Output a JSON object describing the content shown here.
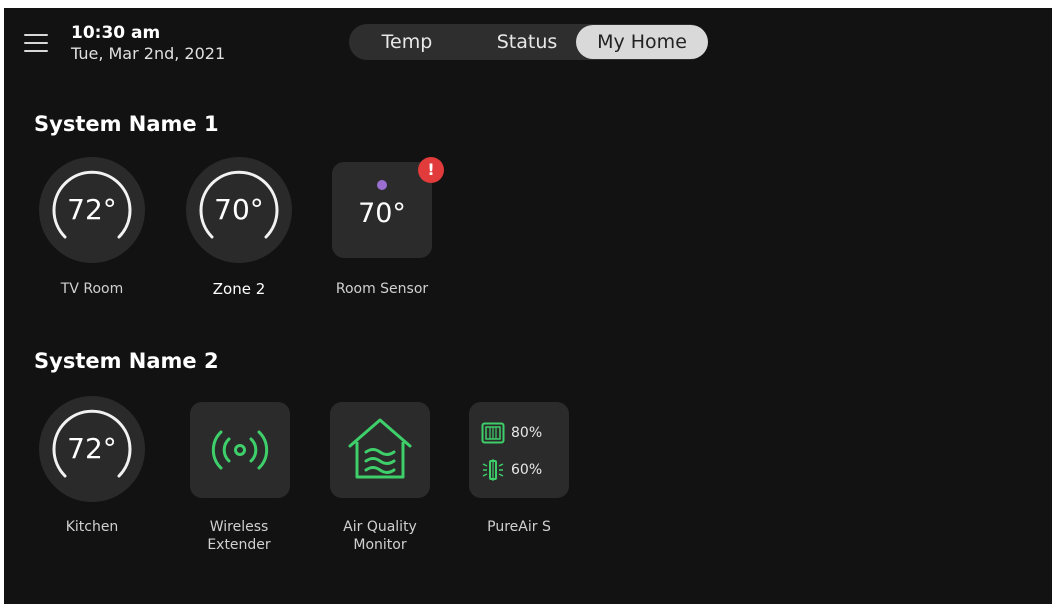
{
  "header": {
    "time": "10:30 am",
    "date": "Tue, Mar 2nd, 2021",
    "menu_icon": "hamburger-icon",
    "tabs": [
      {
        "label": "Temp",
        "active": false
      },
      {
        "label": "Status",
        "active": false
      },
      {
        "label": "My Home",
        "active": true
      }
    ]
  },
  "systems": [
    {
      "name": "System Name 1",
      "devices": [
        {
          "type": "thermostat",
          "temp": "72°",
          "label": "TV Room"
        },
        {
          "type": "thermostat",
          "temp": "70°",
          "label": "Zone 2"
        },
        {
          "type": "sensor",
          "temp": "70°",
          "label": "Room Sensor",
          "alert": "!",
          "dot_color": "#9b6fd0"
        }
      ]
    },
    {
      "name": "System Name 2",
      "devices": [
        {
          "type": "thermostat",
          "temp": "72°",
          "label": "Kitchen"
        },
        {
          "type": "icon",
          "icon": "wireless-signal-icon",
          "label_line1": "Wireless",
          "label_line2": "Extender"
        },
        {
          "type": "icon",
          "icon": "house-air-icon",
          "label_line1": "Air Quality",
          "label_line2": "Monitor"
        },
        {
          "type": "pureair",
          "filter_value": "80%",
          "uv_value": "60%",
          "label": "PureAir S",
          "filter_icon": "filter-icon",
          "uv_icon": "uv-lamp-icon"
        }
      ]
    }
  ],
  "colors": {
    "background": "#121212",
    "tile": "#2b2b2b",
    "accent_green": "#3ecf6a",
    "alert_red": "#e13b3b",
    "sensor_purple": "#9b6fd0"
  }
}
